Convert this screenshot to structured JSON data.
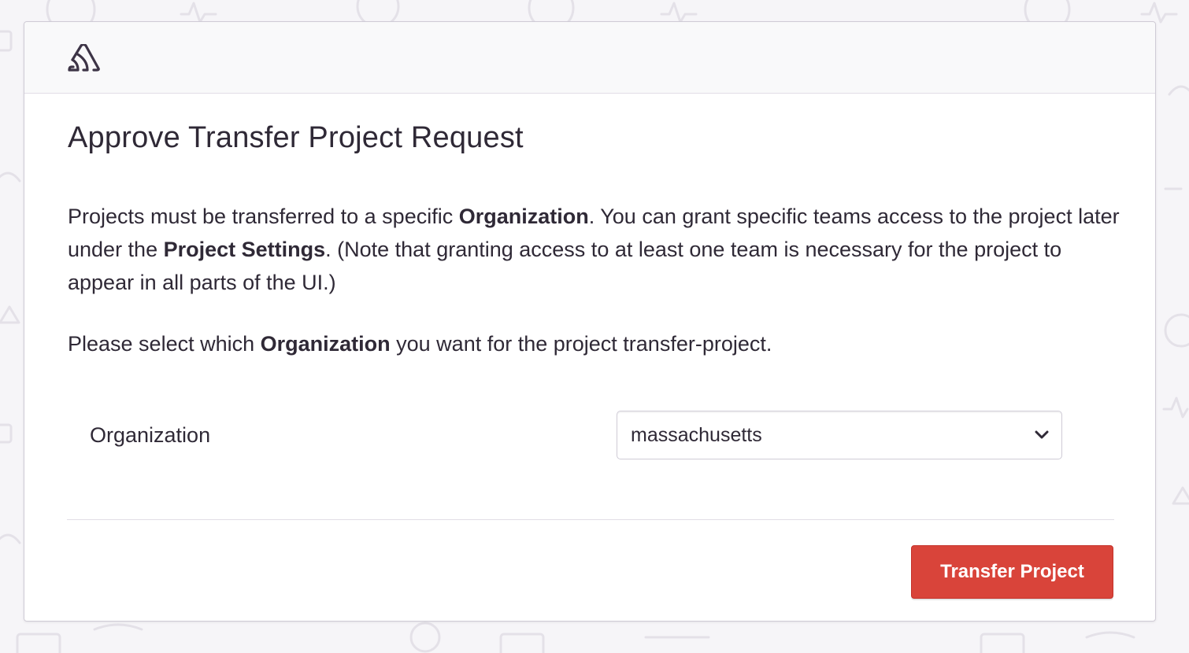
{
  "header": {
    "logo_icon": "sentry-logo-icon"
  },
  "page": {
    "title": "Approve Transfer Project Request",
    "intro": {
      "part1": "Projects must be transferred to a specific ",
      "bold1": "Organization",
      "part2": ". You can grant specific teams access to the project later under the ",
      "bold2": "Project Settings",
      "part3": ". (Note that granting access to at least one team is necessary for the project to appear in all parts of the UI.)"
    },
    "select_prompt": {
      "part1": "Please select which ",
      "bold": "Organization",
      "part2": " you want for the project transfer-project."
    }
  },
  "form": {
    "organization_label": "Organization",
    "organization_value": "massachusetts",
    "dropdown_icon": "chevron-down-icon"
  },
  "actions": {
    "transfer_label": "Transfer Project"
  },
  "colors": {
    "primary_button": "#d9443a",
    "text": "#2f2936",
    "background": "#f6f5f8"
  }
}
